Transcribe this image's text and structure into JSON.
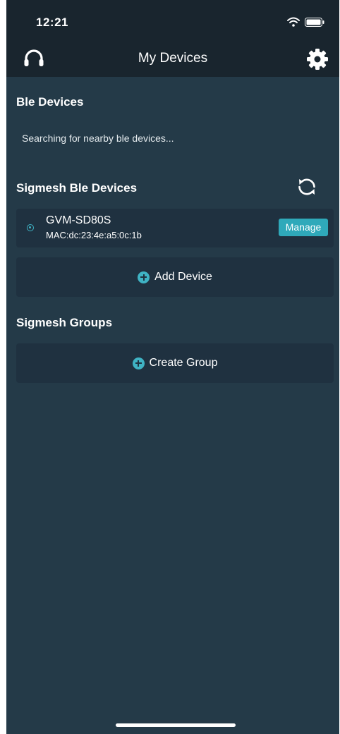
{
  "status_bar": {
    "time": "12:21"
  },
  "nav": {
    "title": "My Devices",
    "left_icon": "headset-icon",
    "right_icon": "gear-icon"
  },
  "ble_section": {
    "title": "Ble Devices",
    "status_text": "Searching for nearby ble devices..."
  },
  "sigmesh_devices": {
    "title": "Sigmesh Ble Devices",
    "refresh_icon": "refresh-icon",
    "devices": [
      {
        "name": "GVM-SD80S",
        "mac": "MAC:dc:23:4e:a5:0c:1b",
        "manage_label": "Manage"
      }
    ],
    "add_label": "Add Device"
  },
  "sigmesh_groups": {
    "title": "Sigmesh Groups",
    "create_label": "Create Group"
  },
  "colors": {
    "background": "#243a48",
    "header": "#19252e",
    "card": "#1f3140",
    "accent": "#3fb3c4",
    "manage_button": "#2fa9ba"
  }
}
